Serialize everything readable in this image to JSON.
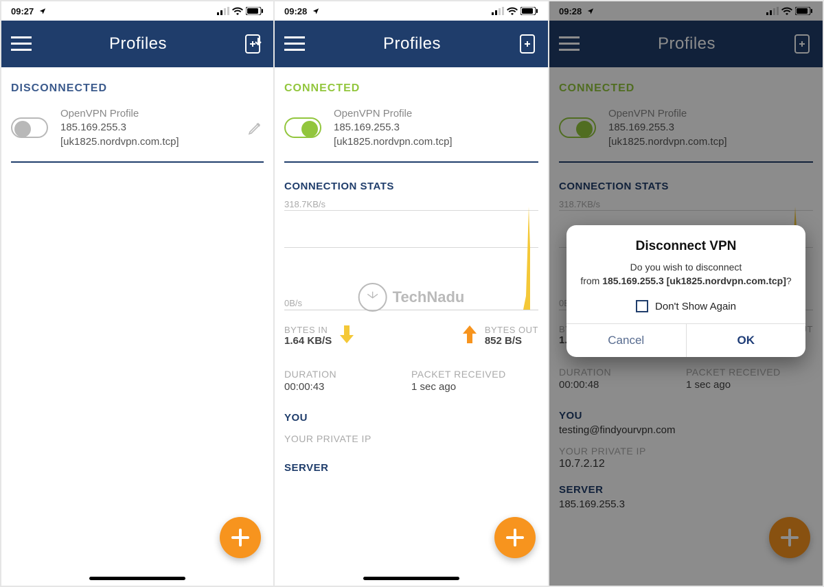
{
  "watermark": {
    "text": "TechNadu"
  },
  "screens": [
    {
      "time": "09:27",
      "title": "Profiles",
      "status": {
        "state": "DISCONNECTED",
        "class": "status-disconnected"
      },
      "toggle": "off",
      "profile": {
        "type": "OpenVPN Profile",
        "ip": "185.169.255.3",
        "host": "[uk1825.nordvpn.com.tcp]"
      },
      "show_edit": true,
      "show_stats": false,
      "show_fab": true,
      "dialog": false
    },
    {
      "time": "09:28",
      "title": "Profiles",
      "status": {
        "state": "CONNECTED",
        "class": "status-connected"
      },
      "toggle": "on",
      "profile": {
        "type": "OpenVPN Profile",
        "ip": "185.169.255.3",
        "host": "[uk1825.nordvpn.com.tcp]"
      },
      "show_edit": false,
      "show_stats": true,
      "stats": {
        "header": "CONNECTION STATS",
        "chart_top": "318.7KB/s",
        "chart_bottom": "0B/s",
        "bytes_in_label": "BYTES IN",
        "bytes_in": "1.64 KB/S",
        "bytes_out_label": "BYTES OUT",
        "bytes_out": "852 B/S",
        "duration_label": "DURATION",
        "duration": "00:00:43",
        "packet_label": "PACKET RECEIVED",
        "packet": "1 sec ago",
        "you_label": "YOU",
        "you": "",
        "private_ip_label": "YOUR PRIVATE IP",
        "private_ip": "",
        "server_label": "SERVER",
        "server": ""
      },
      "show_fab": true,
      "dialog": false
    },
    {
      "time": "09:28",
      "title": "Profiles",
      "status": {
        "state": "CONNECTED",
        "class": "status-connected"
      },
      "toggle": "on",
      "profile": {
        "type": "OpenVPN Profile",
        "ip": "185.169.255.3",
        "host": "[uk1825.nordvpn.com.tcp]"
      },
      "show_edit": false,
      "show_stats": true,
      "stats": {
        "header": "CONNECTION STATS",
        "chart_top": "318.7KB/s",
        "chart_bottom": "0B/s",
        "bytes_in_label": "BYTES IN",
        "bytes_in": "1.64 KB/S",
        "bytes_out_label": "BYTES OUT",
        "bytes_out": "852 B/S",
        "duration_label": "DURATION",
        "duration": "00:00:48",
        "packet_label": "PACKET RECEIVED",
        "packet": "1 sec ago",
        "you_label": "YOU",
        "you": "testing@findyourvpn.com",
        "private_ip_label": "YOUR PRIVATE IP",
        "private_ip": "10.7.2.12",
        "server_label": "SERVER",
        "server": "185.169.255.3"
      },
      "show_fab": true,
      "dialog": {
        "title": "Disconnect VPN",
        "msg_line1": "Do you wish to disconnect",
        "msg_prefix": "from ",
        "msg_bold": "185.169.255.3 [uk1825.nordvpn.com.tcp]",
        "msg_suffix": "?",
        "check_label": "Don't Show Again",
        "cancel": "Cancel",
        "ok": "OK"
      }
    }
  ]
}
